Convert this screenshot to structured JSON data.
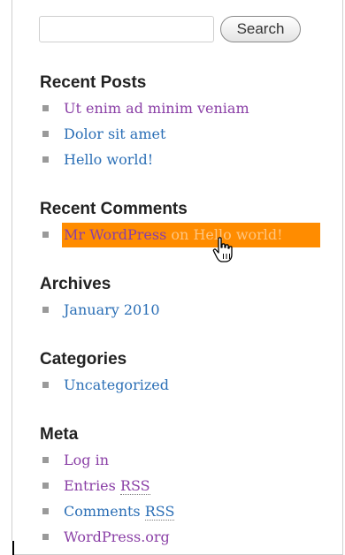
{
  "search": {
    "input_value": "",
    "button_label": "Search"
  },
  "recent_posts": {
    "title": "Recent Posts",
    "items": [
      "Ut enim ad minim veniam",
      "Dolor sit amet",
      "Hello world!"
    ]
  },
  "recent_comments": {
    "title": "Recent Comments",
    "items": [
      {
        "author": "Mr WordPress",
        "on": "on",
        "post": "Hello world!"
      }
    ]
  },
  "archives": {
    "title": "Archives",
    "items": [
      "January 2010"
    ]
  },
  "categories": {
    "title": "Categories",
    "items": [
      "Uncategorized"
    ]
  },
  "meta": {
    "title": "Meta",
    "items": [
      {
        "label": "Log in"
      },
      {
        "label": "Entries",
        "abbr": "RSS"
      },
      {
        "label": "Comments",
        "abbr": "RSS"
      },
      {
        "label": "WordPress.org"
      }
    ]
  },
  "colors": {
    "visited_link": "#8a3fa6",
    "link": "#2b6fb6",
    "highlight": "#ff8c00",
    "bullet": "#9a9a9a"
  },
  "icons": {
    "cursor": "hand-pointer-icon",
    "bullet": "square-bullet-icon"
  }
}
